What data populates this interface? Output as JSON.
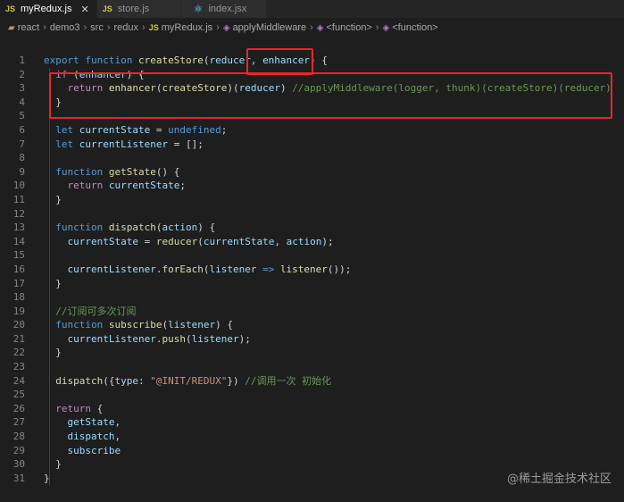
{
  "tabs": [
    {
      "icon": "JS",
      "label": "myRedux.js",
      "active": true,
      "close": "✕"
    },
    {
      "icon": "JS",
      "label": "store.js",
      "active": false
    },
    {
      "icon": "⚛",
      "label": "index.jsx",
      "active": false
    }
  ],
  "breadcrumb": {
    "folders": [
      "react",
      "demo3",
      "src",
      "redux"
    ],
    "file": "myRedux.js",
    "symbols": [
      "applyMiddleware",
      "<function>",
      "<function>"
    ]
  },
  "code_lines": [
    {
      "n": "1",
      "t": [
        [
          "kw",
          "export "
        ],
        [
          "kw",
          "function "
        ],
        [
          "fn",
          "createStore"
        ],
        [
          "p",
          "("
        ],
        [
          "var",
          "reducer"
        ],
        [
          "p",
          ", "
        ],
        [
          "var",
          "enhancer"
        ],
        [
          "p",
          ") {"
        ]
      ]
    },
    {
      "n": "2",
      "t": [
        [
          "p",
          "  "
        ],
        [
          "ctl",
          "if "
        ],
        [
          "p",
          "("
        ],
        [
          "var",
          "enhancer"
        ],
        [
          "p",
          ") {"
        ]
      ]
    },
    {
      "n": "3",
      "t": [
        [
          "p",
          "    "
        ],
        [
          "ctl",
          "return "
        ],
        [
          "fn",
          "enhancer"
        ],
        [
          "p",
          "("
        ],
        [
          "fn",
          "createStore"
        ],
        [
          "p",
          ")("
        ],
        [
          "var",
          "reducer"
        ],
        [
          "p",
          ") "
        ],
        [
          "cmt",
          "//applyMiddleware(logger, thunk)(createStore)(reducer)"
        ]
      ]
    },
    {
      "n": "4",
      "t": [
        [
          "p",
          "  }"
        ]
      ]
    },
    {
      "n": "5",
      "t": []
    },
    {
      "n": "6",
      "t": [
        [
          "p",
          "  "
        ],
        [
          "kw",
          "let "
        ],
        [
          "var",
          "currentState"
        ],
        [
          "p",
          " = "
        ],
        [
          "kw",
          "undefined"
        ],
        [
          "p",
          ";"
        ]
      ]
    },
    {
      "n": "7",
      "t": [
        [
          "p",
          "  "
        ],
        [
          "kw",
          "let "
        ],
        [
          "var",
          "currentListener"
        ],
        [
          "p",
          " = [];"
        ]
      ]
    },
    {
      "n": "8",
      "t": []
    },
    {
      "n": "9",
      "t": [
        [
          "p",
          "  "
        ],
        [
          "kw",
          "function "
        ],
        [
          "fn",
          "getState"
        ],
        [
          "p",
          "() {"
        ]
      ]
    },
    {
      "n": "10",
      "t": [
        [
          "p",
          "    "
        ],
        [
          "ctl",
          "return "
        ],
        [
          "var",
          "currentState"
        ],
        [
          "p",
          ";"
        ]
      ]
    },
    {
      "n": "11",
      "t": [
        [
          "p",
          "  }"
        ]
      ]
    },
    {
      "n": "12",
      "t": []
    },
    {
      "n": "13",
      "t": [
        [
          "p",
          "  "
        ],
        [
          "kw",
          "function "
        ],
        [
          "fn",
          "dispatch"
        ],
        [
          "p",
          "("
        ],
        [
          "var",
          "action"
        ],
        [
          "p",
          ") {"
        ]
      ]
    },
    {
      "n": "14",
      "t": [
        [
          "p",
          "    "
        ],
        [
          "var",
          "currentState"
        ],
        [
          "p",
          " = "
        ],
        [
          "fn",
          "reducer"
        ],
        [
          "p",
          "("
        ],
        [
          "var",
          "currentState"
        ],
        [
          "p",
          ", "
        ],
        [
          "var",
          "action"
        ],
        [
          "p",
          ");"
        ]
      ]
    },
    {
      "n": "15",
      "t": []
    },
    {
      "n": "16",
      "t": [
        [
          "p",
          "    "
        ],
        [
          "var",
          "currentListener"
        ],
        [
          "p",
          "."
        ],
        [
          "fn",
          "forEach"
        ],
        [
          "p",
          "("
        ],
        [
          "var",
          "listener"
        ],
        [
          "p",
          " "
        ],
        [
          "kw",
          "=>"
        ],
        [
          "p",
          " "
        ],
        [
          "fn",
          "listener"
        ],
        [
          "p",
          "());"
        ]
      ]
    },
    {
      "n": "17",
      "t": [
        [
          "p",
          "  }"
        ]
      ]
    },
    {
      "n": "18",
      "t": []
    },
    {
      "n": "19",
      "t": [
        [
          "p",
          "  "
        ],
        [
          "cmt",
          "//订阅可多次订阅"
        ]
      ]
    },
    {
      "n": "20",
      "t": [
        [
          "p",
          "  "
        ],
        [
          "kw",
          "function "
        ],
        [
          "fn",
          "subscribe"
        ],
        [
          "p",
          "("
        ],
        [
          "var",
          "listener"
        ],
        [
          "p",
          ") {"
        ]
      ]
    },
    {
      "n": "21",
      "t": [
        [
          "p",
          "    "
        ],
        [
          "var",
          "currentListener"
        ],
        [
          "p",
          "."
        ],
        [
          "fn",
          "push"
        ],
        [
          "p",
          "("
        ],
        [
          "var",
          "listener"
        ],
        [
          "p",
          ");"
        ]
      ]
    },
    {
      "n": "22",
      "t": [
        [
          "p",
          "  }"
        ]
      ]
    },
    {
      "n": "23",
      "t": []
    },
    {
      "n": "24",
      "t": [
        [
          "p",
          "  "
        ],
        [
          "fn",
          "dispatch"
        ],
        [
          "p",
          "({"
        ],
        [
          "var",
          "type"
        ],
        [
          "p",
          ": "
        ],
        [
          "str",
          "\"@INIT/REDUX\""
        ],
        [
          "p",
          "}) "
        ],
        [
          "cmt",
          "//调用一次 初始化"
        ]
      ]
    },
    {
      "n": "25",
      "t": []
    },
    {
      "n": "26",
      "t": [
        [
          "p",
          "  "
        ],
        [
          "ctl",
          "return "
        ],
        [
          "p",
          "{"
        ]
      ]
    },
    {
      "n": "27",
      "t": [
        [
          "p",
          "    "
        ],
        [
          "var",
          "getState"
        ],
        [
          "p",
          ","
        ]
      ]
    },
    {
      "n": "28",
      "t": [
        [
          "p",
          "    "
        ],
        [
          "var",
          "dispatch"
        ],
        [
          "p",
          ","
        ]
      ]
    },
    {
      "n": "29",
      "t": [
        [
          "p",
          "    "
        ],
        [
          "var",
          "subscribe"
        ]
      ]
    },
    {
      "n": "30",
      "t": [
        [
          "p",
          "  }"
        ]
      ]
    },
    {
      "n": "31",
      "t": [
        [
          "p",
          "}"
        ]
      ]
    }
  ],
  "watermark": "@稀土掘金技术社区",
  "colors": {
    "highlight": "#e8262b",
    "background": "#1e1e1e"
  }
}
